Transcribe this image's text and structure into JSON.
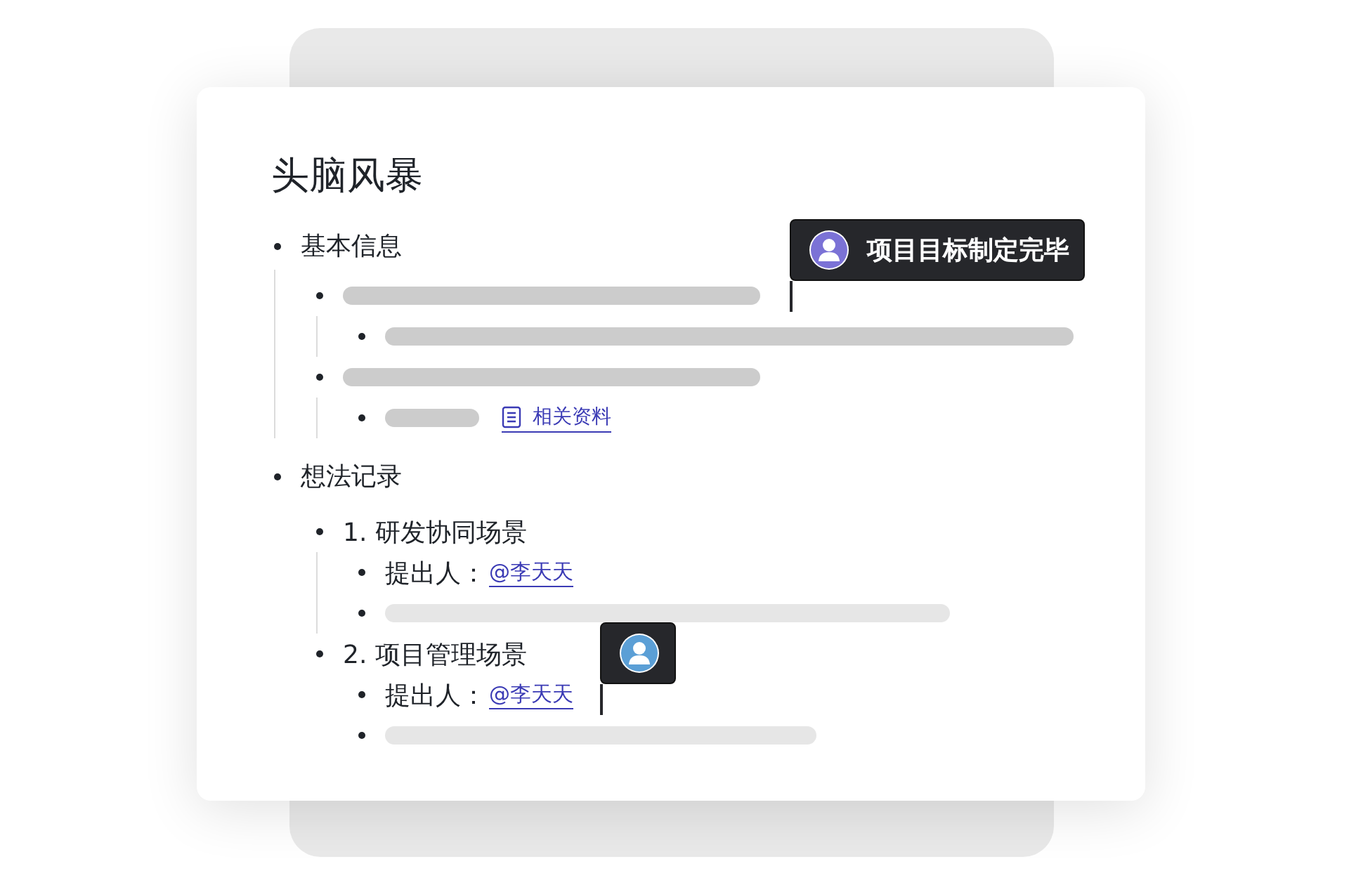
{
  "document": {
    "title": "头脑风暴",
    "outline": [
      {
        "kind": "text",
        "text": "基本信息",
        "guide": true,
        "children": [
          {
            "kind": "bar",
            "guide": true,
            "children": [
              {
                "kind": "bar"
              }
            ]
          },
          {
            "kind": "bar",
            "guide": true,
            "children": [
              {
                "kind": "bar-link",
                "link": "相关资料"
              }
            ]
          }
        ]
      },
      {
        "kind": "text",
        "text": "想法记录",
        "guide": false,
        "children": [
          {
            "kind": "text",
            "text": "1. 研发协同场景",
            "guide": true,
            "children": [
              {
                "kind": "person",
                "text": "提出人：",
                "mention": "@李天天"
              },
              {
                "kind": "bar"
              }
            ]
          },
          {
            "kind": "text",
            "text": "2. 项目管理场景",
            "guide": false,
            "children": [
              {
                "kind": "person",
                "text": "提出人：",
                "mention": "@李天天"
              },
              {
                "kind": "bar"
              }
            ]
          }
        ]
      }
    ]
  },
  "cursors": [
    {
      "label": "项目目标制定完毕",
      "color": "#7b72d6"
    },
    {
      "color": "#5b9fd6"
    }
  ]
}
